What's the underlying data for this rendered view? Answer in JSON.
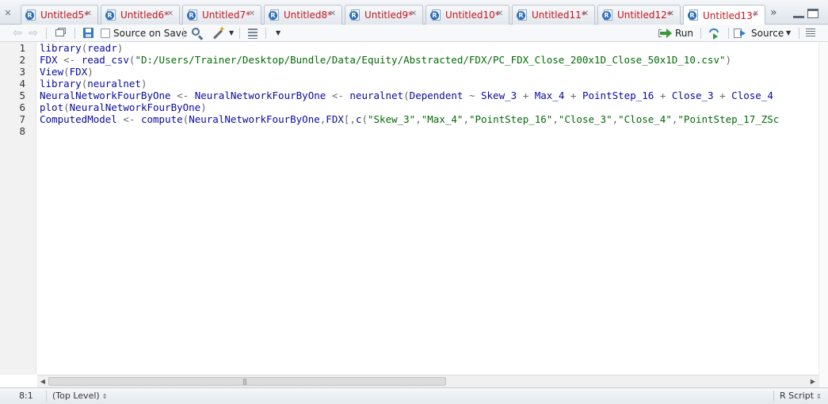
{
  "tabs": [
    {
      "label": "Untitled5*"
    },
    {
      "label": "Untitled6*"
    },
    {
      "label": "Untitled7*"
    },
    {
      "label": "Untitled8*"
    },
    {
      "label": "Untitled9*"
    },
    {
      "label": "Untitled10*"
    },
    {
      "label": "Untitled11*"
    },
    {
      "label": "Untitled12*"
    },
    {
      "label": "Untitled13*",
      "active": true
    }
  ],
  "toolbar": {
    "source_on_save_label": "Source on Save",
    "source_on_save_checked": false,
    "run_label": "Run",
    "source_label": "Source"
  },
  "editor": {
    "line_numbers": [
      "1",
      "2",
      "3",
      "4",
      "5",
      "6",
      "7",
      "8"
    ],
    "lines": [
      "library(readr)",
      "FDX <- read_csv(\"D:/Users/Trainer/Desktop/Bundle/Data/Equity/Abstracted/FDX/PC_FDX_Close_200x1D_Close_50x1D_10.csv\")",
      "View(FDX)",
      "library(neuralnet)",
      "NeuralNetworkFourByOne <- NeuralNetworkFourByOne <- neuralnet(Dependent ~ Skew_3 + Max_4 + PointStep_16 + Close_3 + Close_4",
      "plot(NeuralNetworkFourByOne)",
      "ComputedModel <- compute(NeuralNetworkFourByOne,FDX[,c(\"Skew_3\",\"Max_4\",\"PointStep_16\",\"Close_3\",\"Close_4\",\"PointStep_17_ZSc",
      ""
    ]
  },
  "status": {
    "cursor_position": "8:1",
    "scope": "(Top Level)",
    "file_type": "R Script"
  },
  "colors": {
    "tab_label": "#c1161e",
    "code_keyword": "#0000a0",
    "code_string": "#036a07",
    "run_arrow": "#3a9a3a"
  }
}
